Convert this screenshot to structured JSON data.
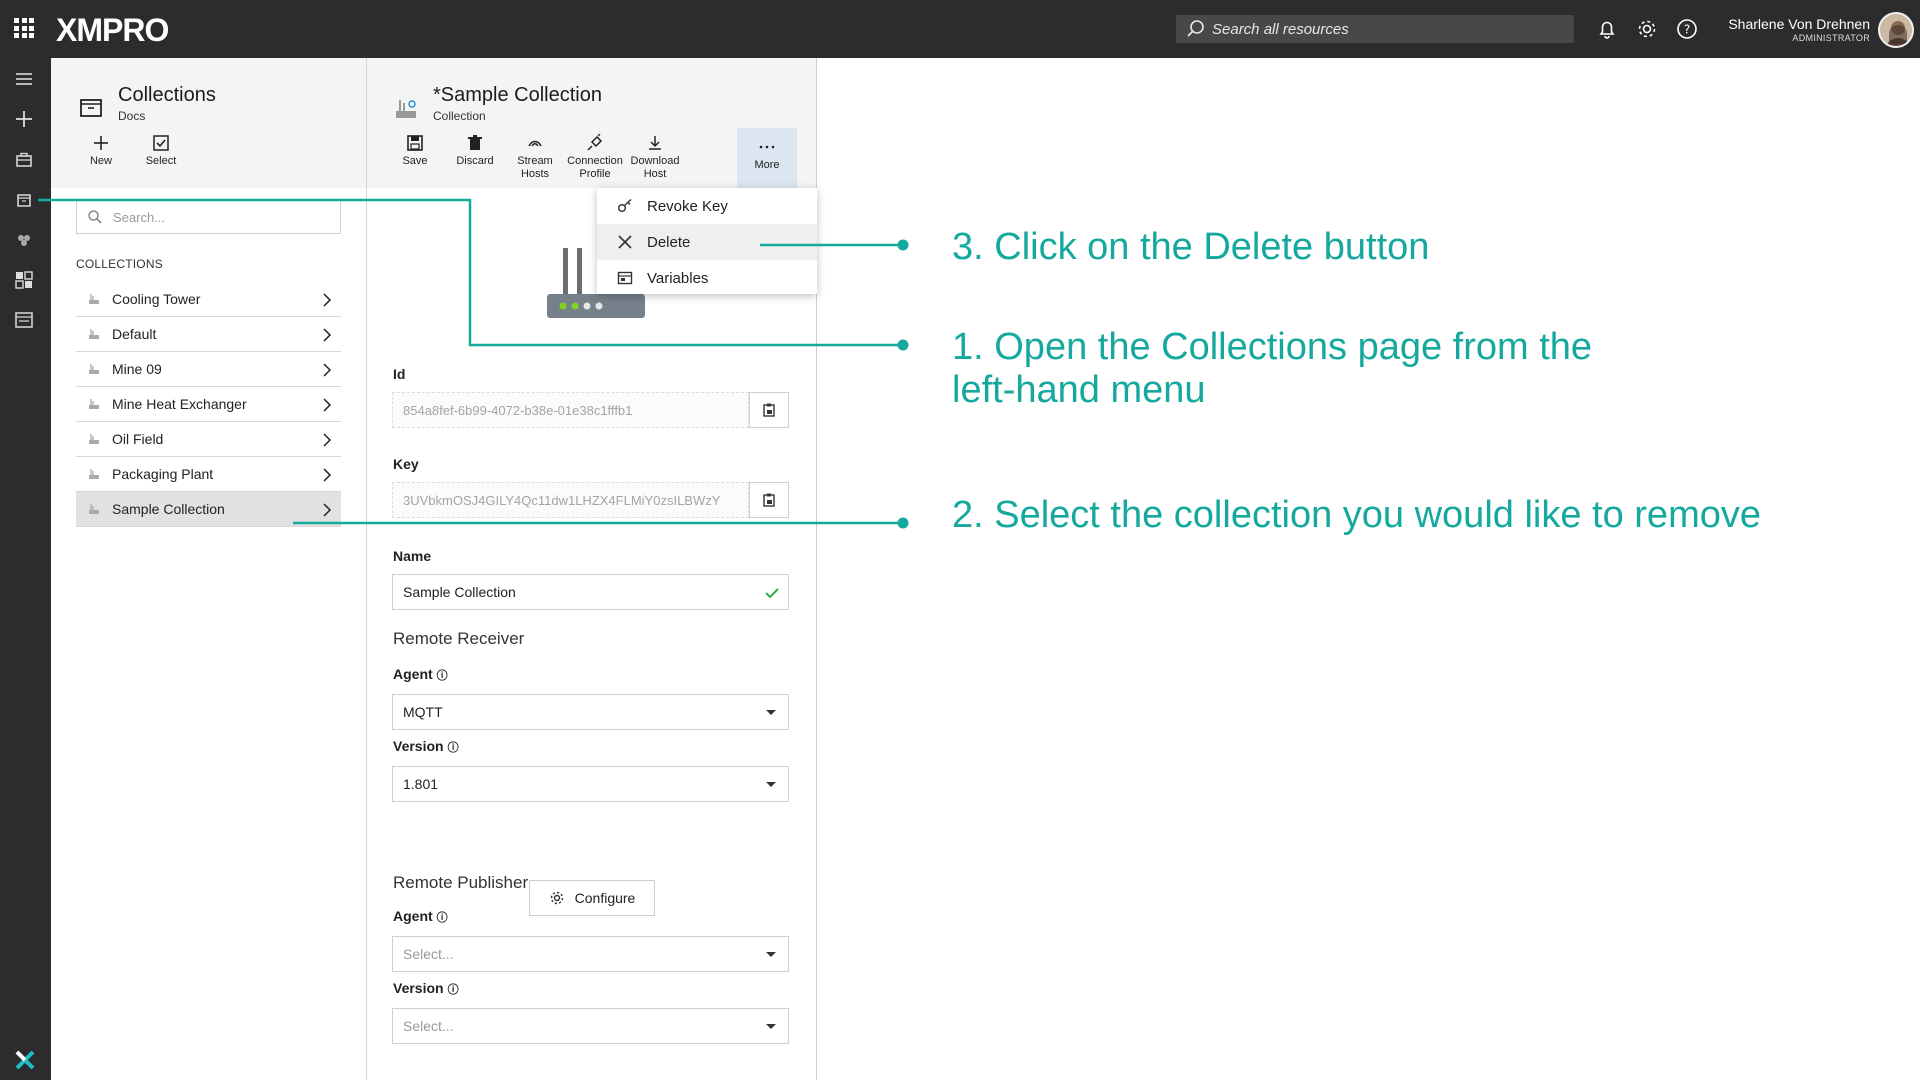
{
  "topbar": {
    "logo": "XMPRO",
    "search_placeholder": "Search all resources",
    "user_name": "Sharlene Von Drehnen",
    "user_role": "ADMINISTRATOR"
  },
  "left_panel": {
    "title": "Collections",
    "subtitle": "Docs",
    "toolbar": [
      {
        "label": "New"
      },
      {
        "label": "Select"
      }
    ],
    "search_placeholder": "Search...",
    "section_label": "COLLECTIONS",
    "items": [
      {
        "label": "Cooling Tower"
      },
      {
        "label": "Default"
      },
      {
        "label": "Mine 09"
      },
      {
        "label": "Mine Heat Exchanger"
      },
      {
        "label": "Oil Field"
      },
      {
        "label": "Packaging Plant"
      },
      {
        "label": "Sample Collection"
      }
    ],
    "selected_item": "Sample Collection"
  },
  "mid_panel": {
    "title": "*Sample Collection",
    "subtitle": "Collection",
    "toolbar": {
      "save": "Save",
      "discard": "Discard",
      "stream_hosts_1": "Stream",
      "stream_hosts_2": "Hosts",
      "connection_profile_1": "Connection",
      "connection_profile_2": "Profile",
      "download_host_1": "Download",
      "download_host_2": "Host",
      "more": "More"
    },
    "more_menu": [
      {
        "label": "Revoke Key",
        "icon": "key-icon"
      },
      {
        "label": "Delete",
        "icon": "close-icon"
      },
      {
        "label": "Variables",
        "icon": "variables-icon"
      }
    ],
    "id_label": "Id",
    "id_value": "854a8fef-6b99-4072-b38e-01e38c1fffb1",
    "key_label": "Key",
    "key_value": "3UVbkmOSJ4GILY4Qc11dw1LHZX4FLMiY0zsILBWzY",
    "name_label": "Name",
    "name_value": "Sample Collection",
    "remote_receiver": {
      "title": "Remote Receiver",
      "agent_label": "Agent",
      "agent_value": "MQTT",
      "version_label": "Version",
      "version_value": "1.801",
      "configure_label": "Configure"
    },
    "remote_publisher": {
      "title": "Remote Publisher",
      "agent_label": "Agent",
      "agent_placeholder": "Select...",
      "version_label": "Version",
      "version_placeholder": "Select..."
    }
  },
  "annotations": {
    "step3": "3. Click on the Delete button",
    "step1_line1": "1. Open the Collections page from the",
    "step1_line2": "left-hand menu",
    "step2": "2. Select the collection you would like to remove"
  },
  "colors": {
    "annotation": "#15a99e",
    "topbar": "#2c2c2c",
    "selected_row": "#e2e2e2",
    "more_active": "#dbe6f1"
  }
}
